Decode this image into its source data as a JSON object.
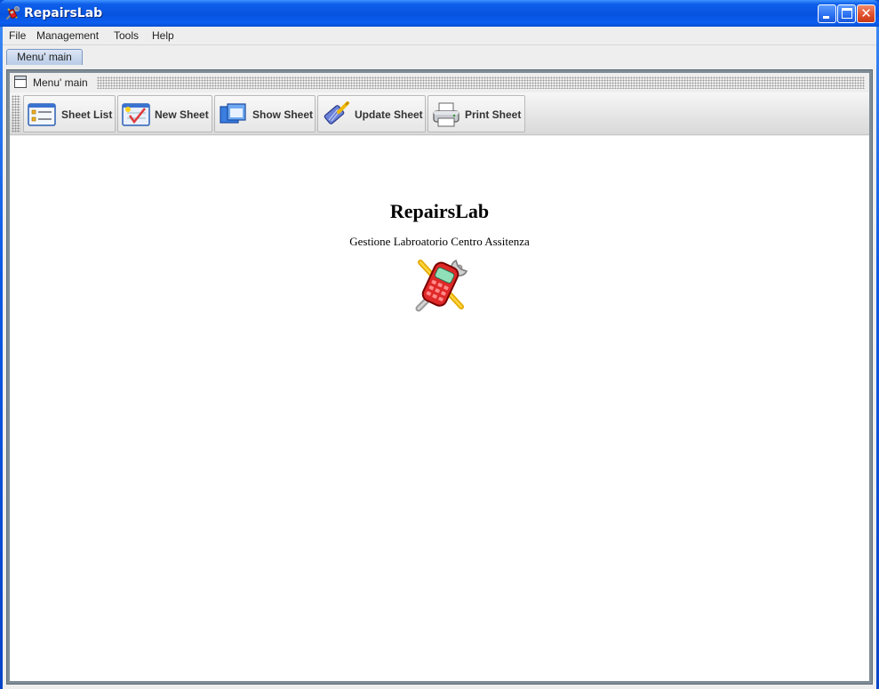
{
  "window": {
    "title": "RepairsLab",
    "app_icon": "repairslab-logo-icon",
    "controls": {
      "minimize": "minimize-icon",
      "maximize": "maximize-icon",
      "close_glyph": "✕"
    }
  },
  "menubar": {
    "items": [
      {
        "label": "File"
      },
      {
        "label": "Management"
      },
      {
        "label": "Tools"
      },
      {
        "label": "Help"
      }
    ]
  },
  "tabs": [
    {
      "label": "Menu' main",
      "active": true
    }
  ],
  "internal_frame": {
    "title": "Menu' main",
    "icon": "window-icon"
  },
  "toolbar": {
    "buttons": [
      {
        "label": "Sheet List",
        "icon": "list-icon"
      },
      {
        "label": "New Sheet",
        "icon": "new-sheet-icon"
      },
      {
        "label": "Show Sheet",
        "icon": "show-sheet-icon"
      },
      {
        "label": "Update Sheet",
        "icon": "update-sheet-icon"
      },
      {
        "label": "Print Sheet",
        "icon": "printer-icon"
      }
    ]
  },
  "splash": {
    "title": "RepairsLab",
    "subtitle": "Gestione Labroatorio Centro Assitenza",
    "logo": "repairslab-logo-icon"
  },
  "colors": {
    "titlebar": "#0753e0",
    "client_bg": "#eeeeee",
    "frame_border": "#7f8c96",
    "content_bg": "#ffffff",
    "tab_bg": "#b8cbe7"
  }
}
